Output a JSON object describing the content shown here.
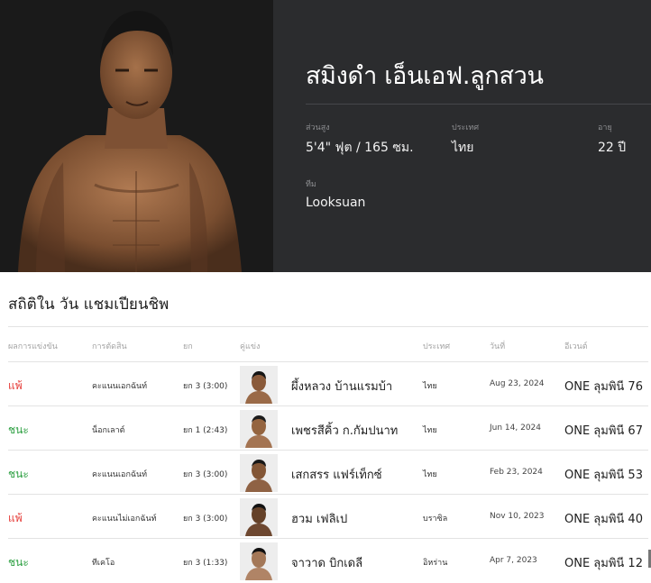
{
  "fighter": {
    "name": "สมิงดำ เอ็นเอฟ.ลูกสวน",
    "height_label": "ส่วนสูง",
    "height_value": "5'4\" ฟุต / 165 ซม.",
    "country_label": "ประเทศ",
    "country_value": "ไทย",
    "age_label": "อายุ",
    "age_value": "22 ปี",
    "team_label": "ทีม",
    "team_value": "Looksuan"
  },
  "stats": {
    "title": "สถิติใน วัน แชมเปียนชิพ",
    "headers": {
      "result": "ผลการแข่งขัน",
      "method": "การตัดสิน",
      "round": "ยก",
      "opponent": "คู่แข่ง",
      "country": "ประเทศ",
      "date": "วันที่",
      "event": "อีเวนต์"
    },
    "rows": [
      {
        "result": "แพ้",
        "outcome": "lose",
        "method": "คะแนนเอกฉันท์",
        "round": "ยก 3 (3:00)",
        "opponent": "ผึ้งหลวง บ้านแรมบ้า",
        "country": "ไทย",
        "date": "Aug 23, 2024",
        "event": "ONE ลุมพินี 76"
      },
      {
        "result": "ชนะ",
        "outcome": "win",
        "method": "น็อกเลาต์",
        "round": "ยก 1 (2:43)",
        "opponent": "เพชรสีคิ้ว ก.กัมปนาท",
        "country": "ไทย",
        "date": "Jun 14, 2024",
        "event": "ONE ลุมพินี 67"
      },
      {
        "result": "ชนะ",
        "outcome": "win",
        "method": "คะแนนเอกฉันท์",
        "round": "ยก 3 (3:00)",
        "opponent": "เสกสรร แฟร์เท็กซ์",
        "country": "ไทย",
        "date": "Feb 23, 2024",
        "event": "ONE ลุมพินี 53"
      },
      {
        "result": "แพ้",
        "outcome": "lose",
        "method": "คะแนนไม่เอกฉันท์",
        "round": "ยก 3 (3:00)",
        "opponent": "ฮวม เฟลิเป",
        "country": "บราซิล",
        "date": "Nov 10, 2023",
        "event": "ONE ลุมพินี 40"
      },
      {
        "result": "ชนะ",
        "outcome": "win",
        "method": "ทีเคโอ",
        "round": "ยก 3 (1:33)",
        "opponent": "จาวาด บิกเดลี",
        "country": "อิหร่าน",
        "date": "Apr 7, 2023",
        "event": "ONE ลุมพินี 12"
      }
    ]
  },
  "colors": {
    "lose": "#e53935",
    "win": "#2ea043",
    "hero_info_bg": "#2b2c2e"
  }
}
